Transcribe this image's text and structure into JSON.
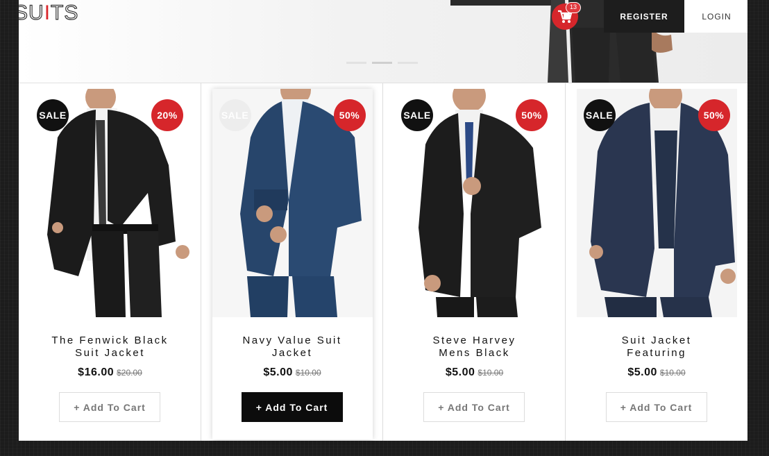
{
  "header": {
    "logo": {
      "before": "SU",
      "accent": "I",
      "after": "TS"
    },
    "cart_count": "13",
    "register_label": "REGISTER",
    "login_label": "LOGIN"
  },
  "colors": {
    "accent": "#d6262b",
    "dark": "#1d1d1d"
  },
  "products": [
    {
      "sale_label": "SALE",
      "discount": "20%",
      "title_line1": "The Fenwick Black",
      "title_line2": "Suit Jacket",
      "price": "$16.00",
      "old_price": "$20.00",
      "add_label": "+ Add To Cart",
      "suit_color": "black"
    },
    {
      "sale_label": "SALE",
      "discount": "50%",
      "title_line1": "Navy Value Suit",
      "title_line2": "Jacket",
      "price": "$5.00",
      "old_price": "$10.00",
      "add_label": "+ Add To Cart",
      "suit_color": "blue"
    },
    {
      "sale_label": "SALE",
      "discount": "50%",
      "title_line1": "Steve Harvey",
      "title_line2": "Mens Black",
      "price": "$5.00",
      "old_price": "$10.00",
      "add_label": "+ Add To Cart",
      "suit_color": "black"
    },
    {
      "sale_label": "SALE",
      "discount": "50%",
      "title_line1": "Suit Jacket",
      "title_line2": "Featuring",
      "price": "$5.00",
      "old_price": "$10.00",
      "add_label": "+ Add To Cart",
      "suit_color": "navy"
    }
  ]
}
